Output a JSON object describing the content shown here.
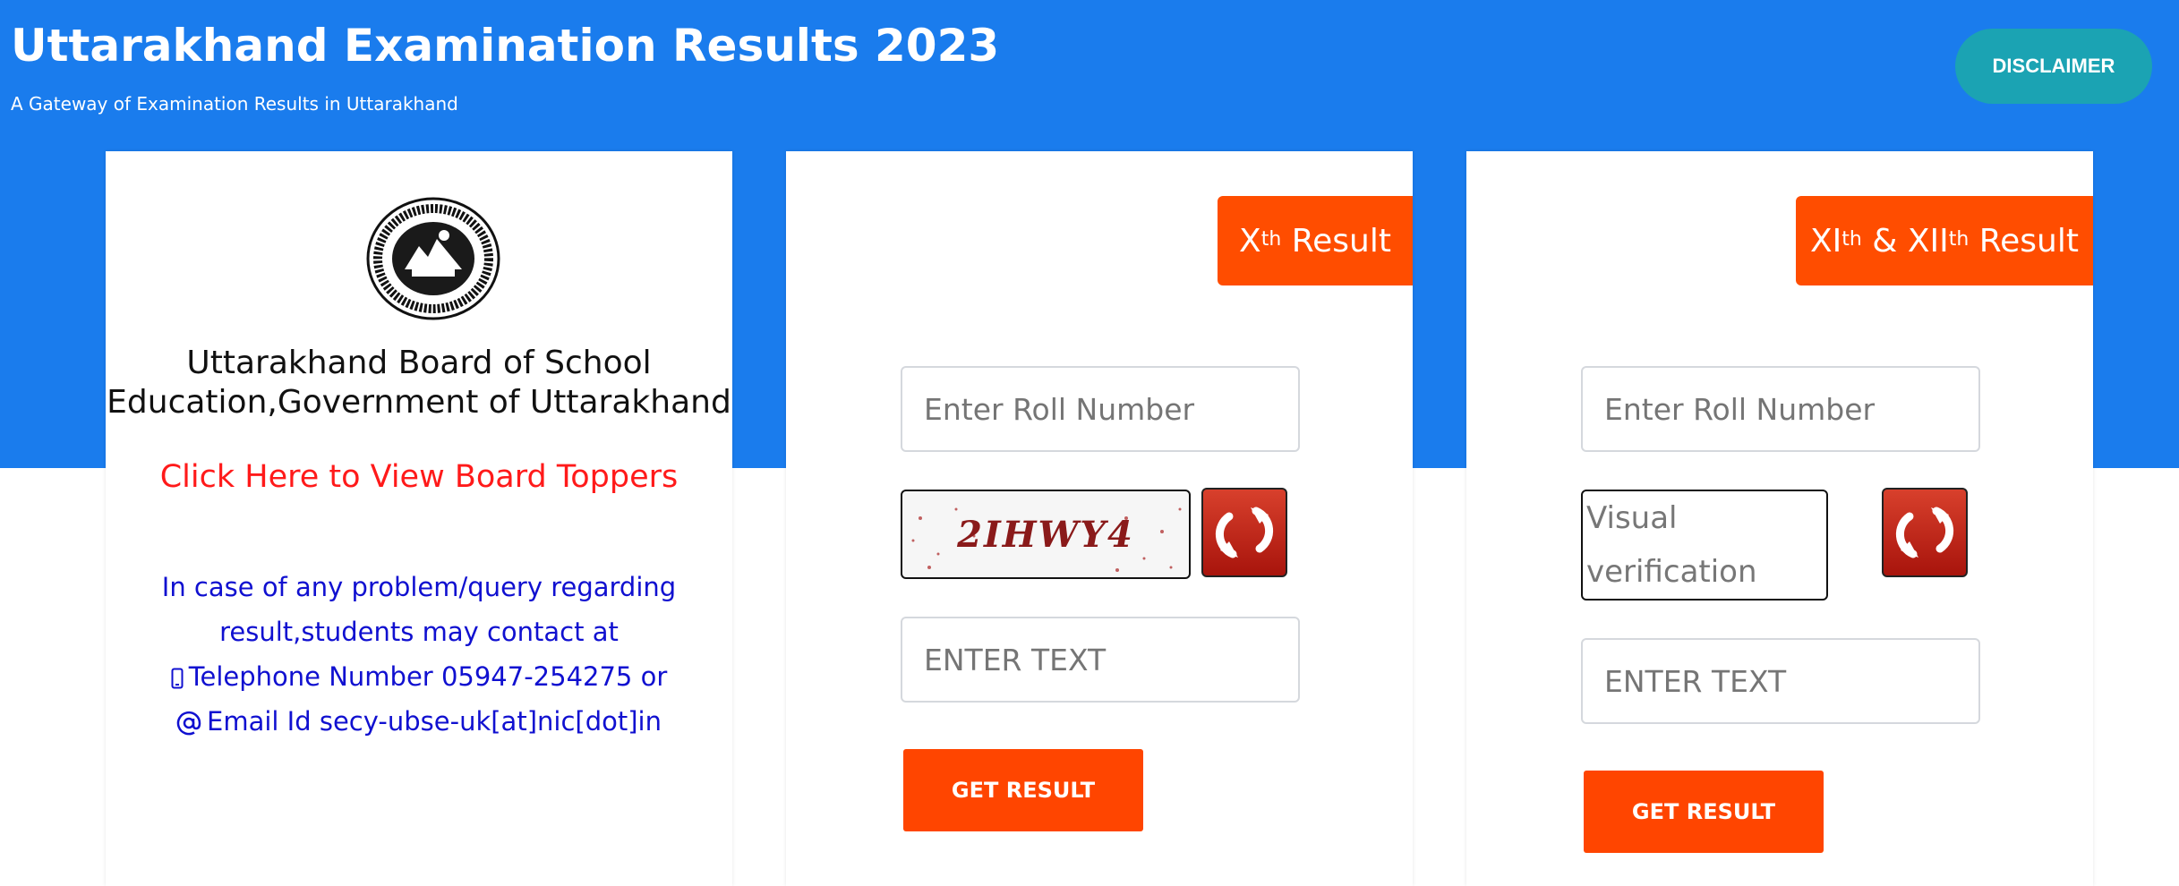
{
  "header": {
    "title": "Uttarakhand Examination Results 2023",
    "subtitle": "A Gateway of Examination Results in Uttarakhand",
    "disclaimer_label": "DISCLAIMER"
  },
  "board_card": {
    "logo_icon": "board-emblem-icon",
    "board_name_line1": "Uttarakhand Board of School",
    "board_name_line2": "Education,Government of Uttarakhand",
    "toppers_link": "Click Here to View Board Toppers",
    "contact_line1": "In case of any problem/query regarding",
    "contact_line2": "result,students may contact at",
    "phone_text": "Telephone Number 05947-254275 or",
    "email_text": "Email Id secy-ubse-uk[at]nic[dot]in",
    "phone_icon": "mobile-phone-icon",
    "email_icon": "at-sign-icon"
  },
  "x_result": {
    "tab_prefix": "X",
    "tab_sup": "th",
    "tab_suffix": " Result",
    "roll_placeholder": "Enter Roll Number",
    "captcha_text": "2IHWY4",
    "captcha_placeholder": "ENTER TEXT",
    "submit_label": "GET RESULT"
  },
  "xii_result": {
    "tab_part1": "XI",
    "tab_sup1": "th",
    "tab_amp": " & XII",
    "tab_sup2": "th",
    "tab_suffix": " Result",
    "roll_placeholder": "Enter Roll Number",
    "captcha_alt": "Visual verification",
    "captcha_placeholder": "ENTER TEXT",
    "submit_label": "GET RESULT"
  },
  "colors": {
    "header_blue": "#1a7ced",
    "accent_orange": "#ff4500",
    "disclaimer_teal": "#1ba3b3",
    "link_red": "#ff1a1a",
    "contact_blue": "#1010d0"
  }
}
